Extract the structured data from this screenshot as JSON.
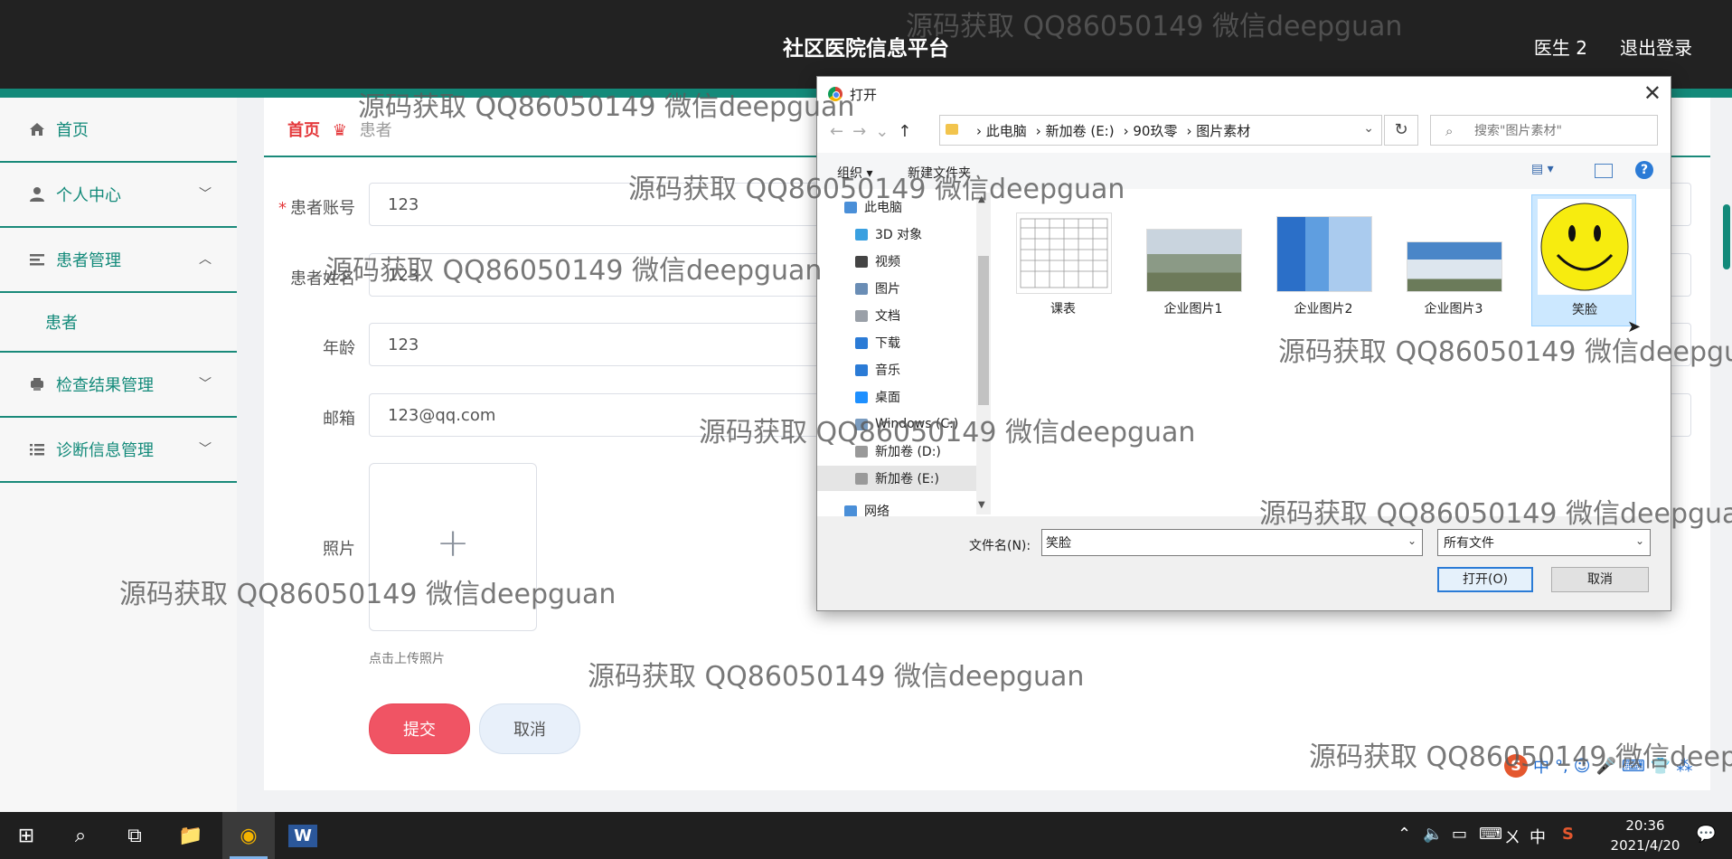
{
  "app": {
    "title": "社区医院信息平台",
    "user": "医生 2",
    "logout": "退出登录"
  },
  "sidebar": {
    "items": [
      {
        "label": "首页",
        "icon": "home-icon"
      },
      {
        "label": "个人中心",
        "icon": "user-icon",
        "chevron": "﹀"
      },
      {
        "label": "患者管理",
        "icon": "list-icon",
        "chevron": "︿"
      },
      {
        "label": "患者",
        "sub": true
      },
      {
        "label": "检查结果管理",
        "icon": "printer-icon",
        "chevron": "﹀"
      },
      {
        "label": "诊断信息管理",
        "icon": "menu-icon",
        "chevron": "﹀"
      }
    ]
  },
  "breadcrumb": {
    "home": "首页",
    "current": "患者"
  },
  "form": {
    "account_label": "患者账号",
    "account_value": "123",
    "name_label": "患者姓名",
    "name_value": "123",
    "age_label": "年龄",
    "age_value": "123",
    "email_label": "邮箱",
    "email_value": "123@qq.com",
    "photo_label": "照片",
    "upload_plus": "+",
    "upload_tip": "点击上传照片",
    "submit_label": "提交",
    "cancel_label": "取消"
  },
  "dialog": {
    "title": "打开",
    "close": "✕",
    "path": [
      "此电脑",
      "新加卷 (E:)",
      "90玖零",
      "图片素材"
    ],
    "search_placeholder": "搜索\"图片素材\"",
    "organize": "组织 ▾",
    "new_folder": "新建文件夹",
    "tree": [
      {
        "label": "此电脑",
        "color": "#4a8fd8"
      },
      {
        "label": "3D 对象",
        "color": "#3aa0e0"
      },
      {
        "label": "视频",
        "color": "#444"
      },
      {
        "label": "图片",
        "color": "#6a8db5"
      },
      {
        "label": "文档",
        "color": "#9aa0a8"
      },
      {
        "label": "下载",
        "color": "#2b7bd6"
      },
      {
        "label": "音乐",
        "color": "#2b7bd6"
      },
      {
        "label": "桌面",
        "color": "#1e90ff"
      },
      {
        "label": "Windows (C:)",
        "color": "#7a9cc0"
      },
      {
        "label": "新加卷 (D:)",
        "color": "#999"
      },
      {
        "label": "新加卷 (E:)",
        "color": "#999"
      },
      {
        "label": "网络",
        "color": "#4a8fd8"
      }
    ],
    "files": [
      "课表",
      "企业图片1",
      "企业图片2",
      "企业图片3",
      "笑脸"
    ],
    "filename_label": "文件名(N):",
    "filename_value": "笑脸",
    "filetype_value": "所有文件",
    "open_label": "打开(O)",
    "cancel_label": "取消"
  },
  "watermark": "源码获取 QQ86050149 微信deepguan",
  "ime": {
    "s": "S",
    "items": [
      "中",
      "°,",
      "☺",
      "🎤",
      "⌨",
      "👕",
      "⁂"
    ]
  },
  "taskbar": {
    "start": "⊞",
    "search": "⌕",
    "taskview": "⧉",
    "explorer": "📁",
    "chrome": "◉",
    "word": "W",
    "tray": [
      "⌃",
      "🔈",
      "▭",
      "⌨",
      "ㄨ",
      "中",
      "S"
    ],
    "time": "20:36",
    "date": "2021/4/20",
    "notify": "💬"
  }
}
